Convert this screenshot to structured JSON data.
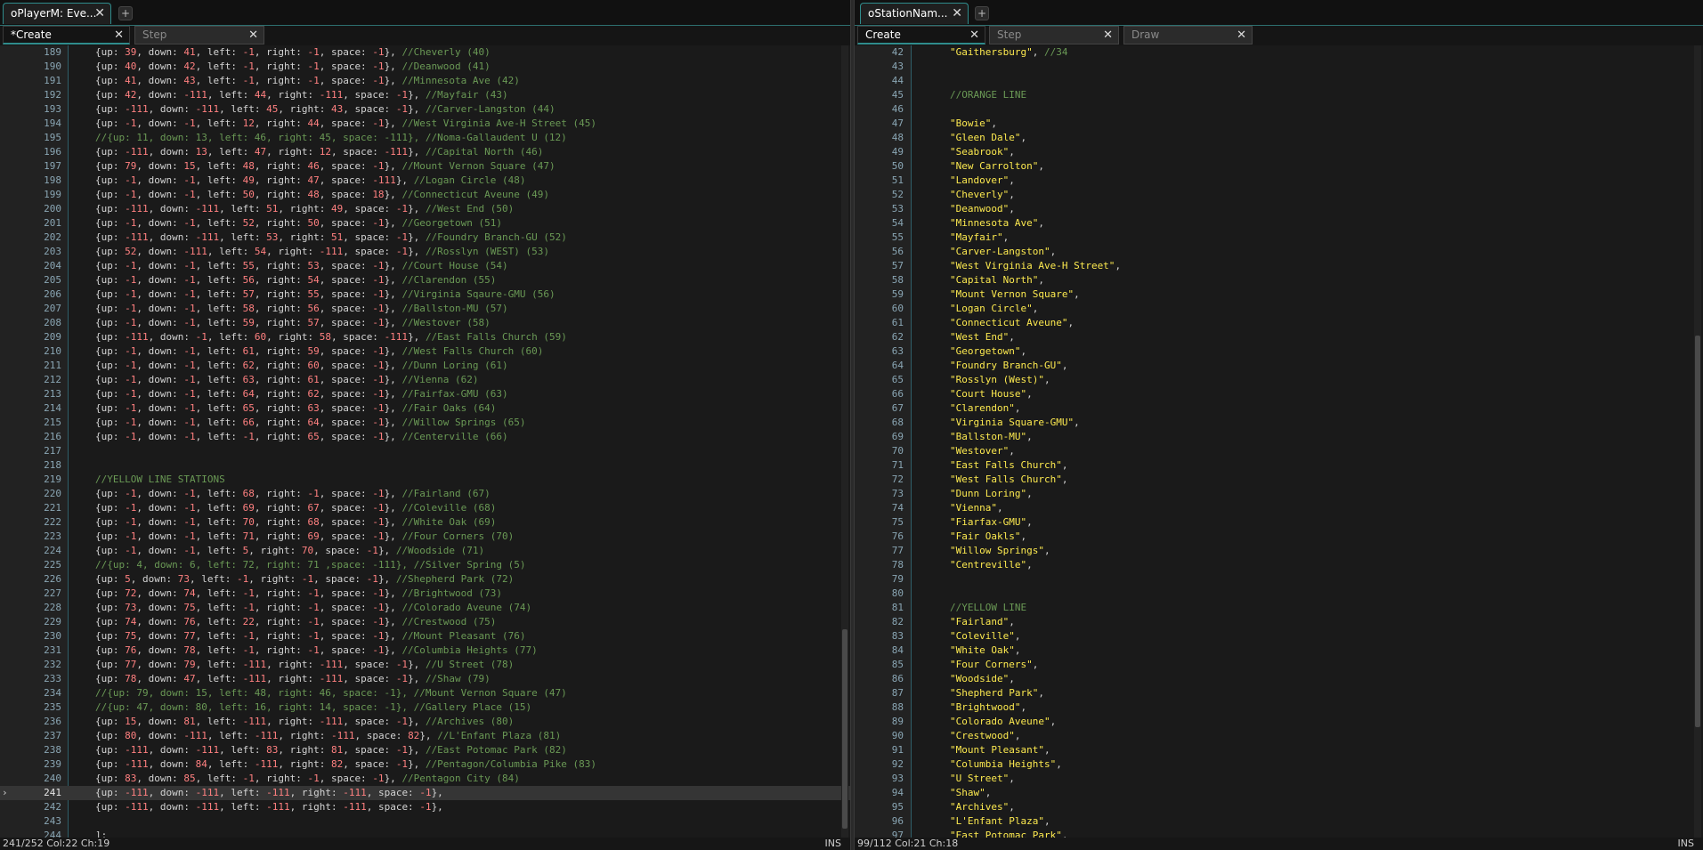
{
  "left": {
    "doc_tab": {
      "label": "oPlayerM: Eve...",
      "close": "✕"
    },
    "add_tab": "+",
    "event_tabs": [
      {
        "label": "*Create",
        "close": "✕",
        "active": true
      },
      {
        "label": "Step",
        "close": "✕",
        "active": false
      }
    ],
    "code": [
      {
        "n": "189",
        "code": "{up: 39, down: 41, left: -1, right: -1, space: -1}, //Cheverly (40)"
      },
      {
        "n": "190",
        "code": "{up: 40, down: 42, left: -1, right: -1, space: -1}, //Deanwood (41)"
      },
      {
        "n": "191",
        "code": "{up: 41, down: 43, left: -1, right: -1, space: -1}, //Minnesota Ave (42)"
      },
      {
        "n": "192",
        "code": "{up: 42, down: -111, left: 44, right: -111, space: -1}, //Mayfair (43)"
      },
      {
        "n": "193",
        "code": "{up: -111, down: -111, left: 45, right: 43, space: -1}, //Carver-Langston (44)"
      },
      {
        "n": "194",
        "code": "{up: -1, down: -1, left: 12, right: 44, space: -1}, //West Virginia Ave-H Street (45)"
      },
      {
        "n": "195",
        "code": "//{up: 11, down: 13, left: 46, right: 45, space: -111}, //Noma-Gallaudent U (12)"
      },
      {
        "n": "196",
        "code": "{up: -111, down: 13, left: 47, right: 12, space: -111}, //Capital North (46)"
      },
      {
        "n": "197",
        "code": "{up: 79, down: 15, left: 48, right: 46, space: -1}, //Mount Vernon Square (47)"
      },
      {
        "n": "198",
        "code": "{up: -1, down: -1, left: 49, right: 47, space: -111}, //Logan Circle (48)"
      },
      {
        "n": "199",
        "code": "{up: -1, down: -1, left: 50, right: 48, space: 18}, //Connecticut Aveune (49)"
      },
      {
        "n": "200",
        "code": "{up: -111, down: -111, left: 51, right: 49, space: -1}, //West End (50)"
      },
      {
        "n": "201",
        "code": "{up: -1, down: -1, left: 52, right: 50, space: -1}, //Georgetown (51)"
      },
      {
        "n": "202",
        "code": "{up: -111, down: -111, left: 53, right: 51, space: -1}, //Foundry Branch-GU (52)"
      },
      {
        "n": "203",
        "code": "{up: 52, down: -111, left: 54, right: -111, space: -1}, //Rosslyn (WEST) (53)"
      },
      {
        "n": "204",
        "code": "{up: -1, down: -1, left: 55, right: 53, space: -1}, //Court House (54)"
      },
      {
        "n": "205",
        "code": "{up: -1, down: -1, left: 56, right: 54, space: -1}, //Clarendon (55)"
      },
      {
        "n": "206",
        "code": "{up: -1, down: -1, left: 57, right: 55, space: -1}, //Virginia Sqaure-GMU (56)"
      },
      {
        "n": "207",
        "code": "{up: -1, down: -1, left: 58, right: 56, space: -1}, //Ballston-MU (57)"
      },
      {
        "n": "208",
        "code": "{up: -1, down: -1, left: 59, right: 57, space: -1}, //Westover (58)"
      },
      {
        "n": "209",
        "code": "{up: -111, down: -1, left: 60, right: 58, space: -111}, //East Falls Church (59)"
      },
      {
        "n": "210",
        "code": "{up: -1, down: -1, left: 61, right: 59, space: -1}, //West Falls Church (60)"
      },
      {
        "n": "211",
        "code": "{up: -1, down: -1, left: 62, right: 60, space: -1}, //Dunn Loring (61)"
      },
      {
        "n": "212",
        "code": "{up: -1, down: -1, left: 63, right: 61, space: -1}, //Vienna (62)"
      },
      {
        "n": "213",
        "code": "{up: -1, down: -1, left: 64, right: 62, space: -1}, //Fairfax-GMU (63)"
      },
      {
        "n": "214",
        "code": "{up: -1, down: -1, left: 65, right: 63, space: -1}, //Fair Oaks (64)"
      },
      {
        "n": "215",
        "code": "{up: -1, down: -1, left: 66, right: 64, space: -1}, //Willow Springs (65)"
      },
      {
        "n": "216",
        "code": "{up: -1, down: -1, left: -1, right: 65, space: -1}, //Centerville (66)"
      },
      {
        "n": "217",
        "code": ""
      },
      {
        "n": "218",
        "code": ""
      },
      {
        "n": "219",
        "code": "//YELLOW LINE STATIONS"
      },
      {
        "n": "220",
        "code": "{up: -1, down: -1, left: 68, right: -1, space: -1}, //Fairland (67)"
      },
      {
        "n": "221",
        "code": "{up: -1, down: -1, left: 69, right: 67, space: -1}, //Coleville (68)"
      },
      {
        "n": "222",
        "code": "{up: -1, down: -1, left: 70, right: 68, space: -1}, //White Oak (69)"
      },
      {
        "n": "223",
        "code": "{up: -1, down: -1, left: 71, right: 69, space: -1}, //Four Corners (70)"
      },
      {
        "n": "224",
        "code": "{up: -1, down: -1, left: 5, right: 70, space: -1}, //Woodside (71)"
      },
      {
        "n": "225",
        "code": "//{up: 4, down: 6, left: 72, right: 71 ,space: -111}, //Silver Spring (5)"
      },
      {
        "n": "226",
        "code": "{up: 5, down: 73, left: -1, right: -1, space: -1}, //Shepherd Park (72)"
      },
      {
        "n": "227",
        "code": "{up: 72, down: 74, left: -1, right: -1, space: -1}, //Brightwood (73)"
      },
      {
        "n": "228",
        "code": "{up: 73, down: 75, left: -1, right: -1, space: -1}, //Colorado Aveune (74)"
      },
      {
        "n": "229",
        "code": "{up: 74, down: 76, left: 22, right: -1, space: -1}, //Crestwood (75)"
      },
      {
        "n": "230",
        "code": "{up: 75, down: 77, left: -1, right: -1, space: -1}, //Mount Pleasant (76)"
      },
      {
        "n": "231",
        "code": "{up: 76, down: 78, left: -1, right: -1, space: -1}, //Columbia Heights (77)"
      },
      {
        "n": "232",
        "code": "{up: 77, down: 79, left: -111, right: -111, space: -1}, //U Street (78)"
      },
      {
        "n": "233",
        "code": "{up: 78, down: 47, left: -111, right: -111, space: -1}, //Shaw (79)"
      },
      {
        "n": "234",
        "code": "//{up: 79, down: 15, left: 48, right: 46, space: -1}, //Mount Vernon Square (47)"
      },
      {
        "n": "235",
        "code": "//{up: 47, down: 80, left: 16, right: 14, space: -1}, //Gallery Place (15)"
      },
      {
        "n": "236",
        "code": "{up: 15, down: 81, left: -111, right: -111, space: -1}, //Archives (80)"
      },
      {
        "n": "237",
        "code": "{up: 80, down: -111, left: -111, right: -111, space: 82}, //L'Enfant Plaza (81)"
      },
      {
        "n": "238",
        "code": "{up: -111, down: -111, left: 83, right: 81, space: -1}, //East Potomac Park (82)"
      },
      {
        "n": "239",
        "code": "{up: -111, down: 84, left: -111, right: 82, space: -1}, //Pentagon/Columbia Pike (83)"
      },
      {
        "n": "240",
        "code": "{up: 83, down: 85, left: -1, right: -1, space: -1}, //Pentagon City (84)"
      },
      {
        "n": "241",
        "code": "{up: -111, down: -111, left: -111, right: -111, space: -1},"
      },
      {
        "n": "242",
        "code": "{up: -111, down: -111, left: -111, right: -111, space: -1},"
      },
      {
        "n": "243",
        "code": ""
      },
      {
        "n": "244",
        "code": "];"
      }
    ],
    "current_line": "241",
    "caret_marker": "›",
    "status_position": "241/252 Col:22 Ch:19",
    "status_mode": "INS"
  },
  "right": {
    "doc_tab": {
      "label": "oStationNam...",
      "close": "✕"
    },
    "add_tab": "+",
    "event_tabs": [
      {
        "label": "Create",
        "close": "✕",
        "active": true
      },
      {
        "label": "Step",
        "close": "✕",
        "active": false
      },
      {
        "label": "Draw",
        "close": "✕",
        "active": false
      }
    ],
    "code": [
      {
        "n": "42",
        "code": "\"Gaithersburg\", //34"
      },
      {
        "n": "43",
        "code": ""
      },
      {
        "n": "44",
        "code": ""
      },
      {
        "n": "45",
        "code": "//ORANGE LINE"
      },
      {
        "n": "46",
        "code": ""
      },
      {
        "n": "47",
        "code": "\"Bowie\","
      },
      {
        "n": "48",
        "code": "\"Gleen Dale\","
      },
      {
        "n": "49",
        "code": "\"Seabrook\","
      },
      {
        "n": "50",
        "code": "\"New Carrolton\","
      },
      {
        "n": "51",
        "code": "\"Landover\","
      },
      {
        "n": "52",
        "code": "\"Cheverly\","
      },
      {
        "n": "53",
        "code": "\"Deanwood\","
      },
      {
        "n": "54",
        "code": "\"Minnesota Ave\","
      },
      {
        "n": "55",
        "code": "\"Mayfair\","
      },
      {
        "n": "56",
        "code": "\"Carver-Langston\","
      },
      {
        "n": "57",
        "code": "\"West Virginia Ave-H Street\","
      },
      {
        "n": "58",
        "code": "\"Capital North\","
      },
      {
        "n": "59",
        "code": "\"Mount Vernon Square\","
      },
      {
        "n": "60",
        "code": "\"Logan Circle\","
      },
      {
        "n": "61",
        "code": "\"Connecticut Aveune\","
      },
      {
        "n": "62",
        "code": "\"West End\","
      },
      {
        "n": "63",
        "code": "\"Georgetown\","
      },
      {
        "n": "64",
        "code": "\"Foundry Branch-GU\","
      },
      {
        "n": "65",
        "code": "\"Rosslyn (West)\","
      },
      {
        "n": "66",
        "code": "\"Court House\","
      },
      {
        "n": "67",
        "code": "\"Clarendon\","
      },
      {
        "n": "68",
        "code": "\"Virginia Square-GMU\","
      },
      {
        "n": "69",
        "code": "\"Ballston-MU\","
      },
      {
        "n": "70",
        "code": "\"Westover\","
      },
      {
        "n": "71",
        "code": "\"East Falls Church\","
      },
      {
        "n": "72",
        "code": "\"West Falls Church\","
      },
      {
        "n": "73",
        "code": "\"Dunn Loring\","
      },
      {
        "n": "74",
        "code": "\"Vienna\","
      },
      {
        "n": "75",
        "code": "\"Fiarfax-GMU\","
      },
      {
        "n": "76",
        "code": "\"Fair Oakls\","
      },
      {
        "n": "77",
        "code": "\"Willow Springs\","
      },
      {
        "n": "78",
        "code": "\"Centreville\","
      },
      {
        "n": "79",
        "code": ""
      },
      {
        "n": "80",
        "code": ""
      },
      {
        "n": "81",
        "code": "//YELLOW LINE"
      },
      {
        "n": "82",
        "code": "\"Fairland\","
      },
      {
        "n": "83",
        "code": "\"Coleville\","
      },
      {
        "n": "84",
        "code": "\"White Oak\","
      },
      {
        "n": "85",
        "code": "\"Four Corners\","
      },
      {
        "n": "86",
        "code": "\"Woodside\","
      },
      {
        "n": "87",
        "code": "\"Shepherd Park\","
      },
      {
        "n": "88",
        "code": "\"Brightwood\","
      },
      {
        "n": "89",
        "code": "\"Colorado Aveune\","
      },
      {
        "n": "90",
        "code": "\"Crestwood\","
      },
      {
        "n": "91",
        "code": "\"Mount Pleasant\","
      },
      {
        "n": "92",
        "code": "\"Columbia Heights\","
      },
      {
        "n": "93",
        "code": "\"U Street\","
      },
      {
        "n": "94",
        "code": "\"Shaw\","
      },
      {
        "n": "95",
        "code": "\"Archives\","
      },
      {
        "n": "96",
        "code": "\"L'Enfant Plaza\","
      },
      {
        "n": "97",
        "code": "\"East Potomac Park\","
      }
    ],
    "status_position": "99/112 Col:21 Ch:18",
    "status_mode": "INS"
  },
  "colors": {
    "accent": "#2f8c8c",
    "number": "#ff8080",
    "comment": "#6a9955",
    "string": "#fce94f"
  }
}
